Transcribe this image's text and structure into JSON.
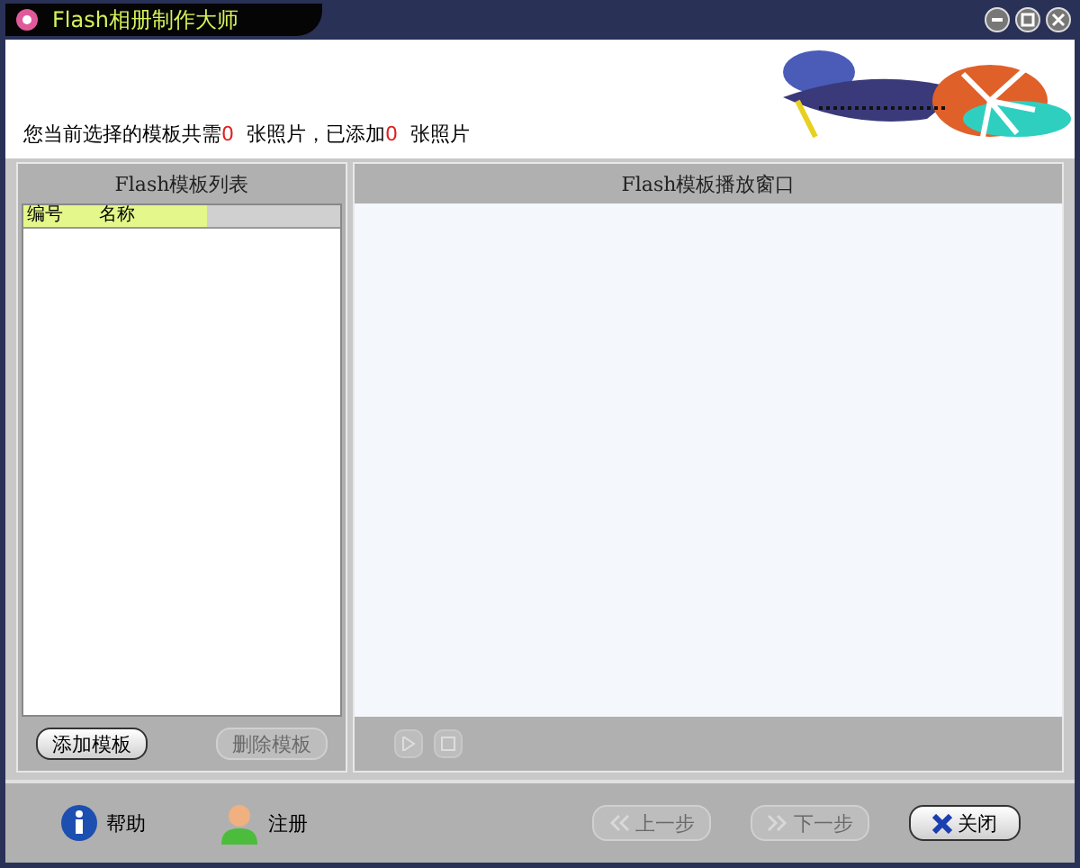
{
  "window": {
    "title": "Flash相册制作大师"
  },
  "notice": {
    "before": "您当前选择的模板共需",
    "required": "0",
    "middle": "张照片，已添加",
    "added": "0",
    "after": "张照片"
  },
  "template_list": {
    "title": "Flash模板列表",
    "columns": [
      "编号",
      "名称"
    ],
    "buttons": [
      {
        "label": "添加模板",
        "disabled": false
      },
      {
        "label": "删除模板",
        "disabled": true
      }
    ]
  },
  "player": {
    "title": "Flash模板播放窗口",
    "controls": [
      {
        "kind": "play",
        "disabled": true
      },
      {
        "kind": "stop",
        "disabled": true
      }
    ]
  },
  "footer": {
    "links": [
      {
        "kind": "help",
        "label": "帮助"
      },
      {
        "kind": "register",
        "label": "注册"
      }
    ],
    "buttons": [
      {
        "kind": "prev",
        "label": "上一步",
        "disabled": true
      },
      {
        "kind": "next",
        "label": "下一步",
        "disabled": true
      },
      {
        "kind": "close",
        "label": "关闭",
        "disabled": false
      }
    ]
  }
}
